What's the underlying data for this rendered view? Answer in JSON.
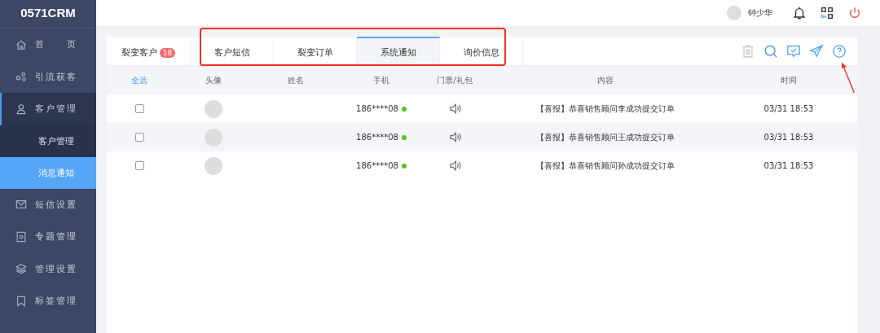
{
  "logo": "0571CRM",
  "sidebar": {
    "items": [
      {
        "label": "首　　页",
        "expanded": false
      },
      {
        "label": "引流获客",
        "expanded": false
      },
      {
        "label": "客户管理",
        "expanded": true,
        "children": [
          {
            "label": "客户管理",
            "selected": false
          },
          {
            "label": "消息通知",
            "selected": true
          }
        ]
      },
      {
        "label": "短信设置",
        "expanded": false
      },
      {
        "label": "专题管理",
        "expanded": false
      },
      {
        "label": "管理设置",
        "expanded": false
      },
      {
        "label": "标签管理",
        "expanded": false
      }
    ]
  },
  "header": {
    "user_name": "钟少华"
  },
  "tabs": [
    {
      "label": "裂变客户",
      "badge": "18",
      "selected": false
    },
    {
      "label": "客户短信",
      "selected": false
    },
    {
      "label": "裂变订单",
      "selected": false
    },
    {
      "label": "系统通知",
      "selected": true
    },
    {
      "label": "询价信息",
      "selected": false
    }
  ],
  "table": {
    "select_all": "全选",
    "columns": [
      "头像",
      "姓名",
      "手机",
      "门票/礼包",
      "内容",
      "时间"
    ],
    "rows": [
      {
        "checked": false,
        "phone": "186****08",
        "content": "【喜报】恭喜销售顾问李成功提交订单",
        "time": "03/31 18:53"
      },
      {
        "checked": false,
        "phone": "186****08",
        "content": "【喜报】恭喜销售顾问王成功提交订单",
        "time": "03/31 18:53"
      },
      {
        "checked": false,
        "phone": "186****08",
        "content": "【喜报】恭喜销售顾问孙成功提交订单",
        "time": "03/31 18:53"
      }
    ]
  }
}
